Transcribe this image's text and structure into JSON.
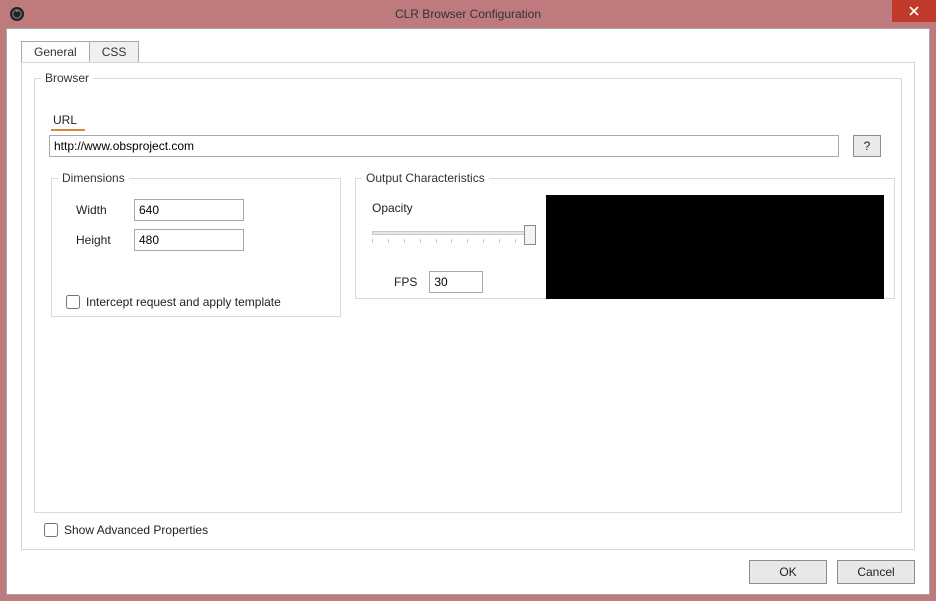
{
  "window": {
    "title": "CLR Browser Configuration"
  },
  "tabs": {
    "general": "General",
    "css": "CSS"
  },
  "browser": {
    "legend": "Browser",
    "url_label": "URL",
    "url_value": "http://www.obsproject.com",
    "help_label": "?"
  },
  "dimensions": {
    "legend": "Dimensions",
    "width_label": "Width",
    "width_value": "640",
    "height_label": "Height",
    "height_value": "480",
    "intercept_label": "Intercept request and apply template"
  },
  "output": {
    "legend": "Output Characteristics",
    "opacity_label": "Opacity",
    "fps_label": "FPS",
    "fps_value": "30"
  },
  "advanced": {
    "show_label": "Show Advanced Properties"
  },
  "buttons": {
    "ok": "OK",
    "cancel": "Cancel"
  }
}
